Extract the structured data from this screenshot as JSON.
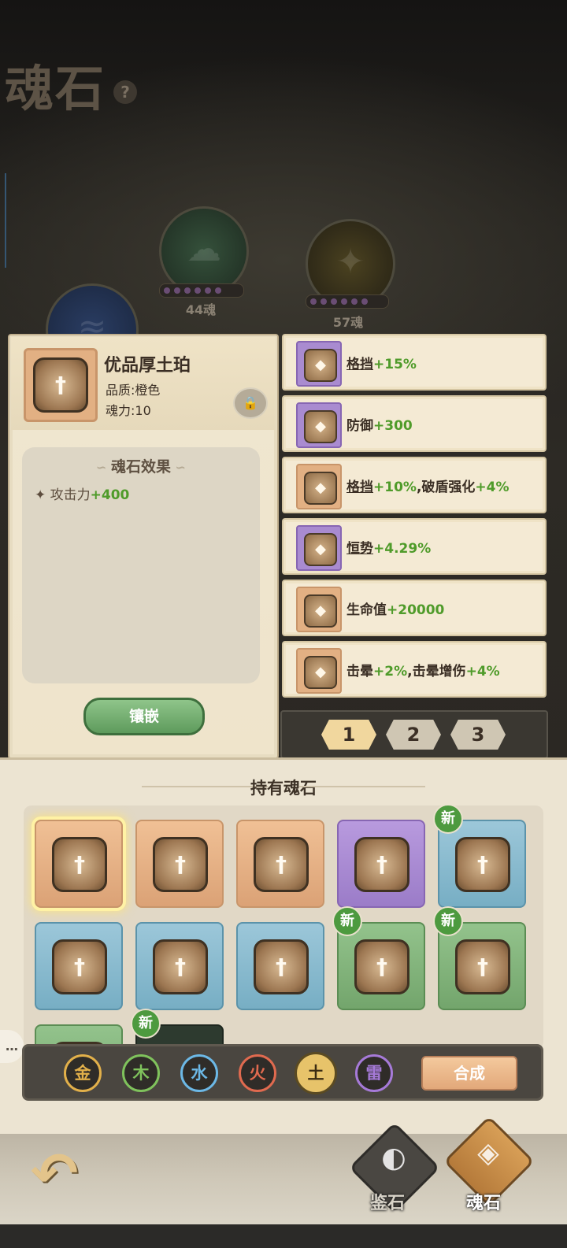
{
  "header": {
    "title": "魂石",
    "help_icon": "?"
  },
  "orbs": [
    {
      "soul": "44魂",
      "color": "green"
    },
    {
      "soul": "57魂",
      "color": "gold"
    }
  ],
  "detail": {
    "name": "优品厚土珀",
    "quality": "品质:橙色",
    "power": "魂力:10",
    "effect_title": "魂石效果",
    "effect_label": "攻击力",
    "effect_value": "+400",
    "inlay_label": "镶嵌"
  },
  "entries": [
    {
      "parts": [
        {
          "t": "格挡",
          "u": true
        },
        {
          "t": "+15%",
          "g": true
        }
      ],
      "color": "purple"
    },
    {
      "parts": [
        {
          "t": "防御"
        },
        {
          "t": "+300",
          "g": true
        }
      ],
      "color": "purple"
    },
    {
      "parts": [
        {
          "t": "格挡",
          "u": true
        },
        {
          "t": "+10%",
          "g": true
        },
        {
          "t": ",破盾强化"
        },
        {
          "t": "+4%",
          "g": true
        }
      ],
      "color": "orange"
    },
    {
      "parts": [
        {
          "t": "恒势",
          "u": true
        },
        {
          "t": "+4.29%",
          "g": true
        }
      ],
      "color": "purple"
    },
    {
      "parts": [
        {
          "t": "生命值"
        },
        {
          "t": "+20000",
          "g": true
        }
      ],
      "color": "orange"
    },
    {
      "parts": [
        {
          "t": "击晕"
        },
        {
          "t": "+2%",
          "g": true
        },
        {
          "t": ",击晕增伤"
        },
        {
          "t": "+4%",
          "g": true
        }
      ],
      "color": "orange"
    }
  ],
  "pager": {
    "pages": [
      "1",
      "2",
      "3"
    ],
    "active": "1"
  },
  "owned": {
    "title": "持有魂石",
    "new_label": "新",
    "tiles": [
      {
        "color": "orange",
        "selected": true,
        "is_new": false
      },
      {
        "color": "orange",
        "selected": false,
        "is_new": false
      },
      {
        "color": "orange",
        "selected": false,
        "is_new": false
      },
      {
        "color": "purple",
        "selected": false,
        "is_new": false
      },
      {
        "color": "blue",
        "selected": false,
        "is_new": true
      },
      {
        "color": "blue",
        "selected": false,
        "is_new": false
      },
      {
        "color": "blue",
        "selected": false,
        "is_new": false
      },
      {
        "color": "blue",
        "selected": false,
        "is_new": false
      },
      {
        "color": "green",
        "selected": false,
        "is_new": true
      },
      {
        "color": "green",
        "selected": false,
        "is_new": true
      },
      {
        "color": "green",
        "selected": false,
        "is_new": false
      },
      {
        "color": "dark",
        "selected": false,
        "is_new": true
      }
    ]
  },
  "filters": {
    "elements": [
      {
        "label": "金",
        "color": "#e2b04a"
      },
      {
        "label": "木",
        "color": "#7fc25c"
      },
      {
        "label": "水",
        "color": "#6cb8e6"
      },
      {
        "label": "火",
        "color": "#e06a4f"
      },
      {
        "label": "土",
        "color": "#e7c36a"
      },
      {
        "label": "雷",
        "color": "#a67ad8"
      }
    ],
    "active": "土",
    "combine_label": "合成"
  },
  "chat_tab": "…",
  "nav": {
    "back_icon": "back-arrow-icon",
    "appraise_label": "鉴石",
    "soul_label": "魂石"
  }
}
